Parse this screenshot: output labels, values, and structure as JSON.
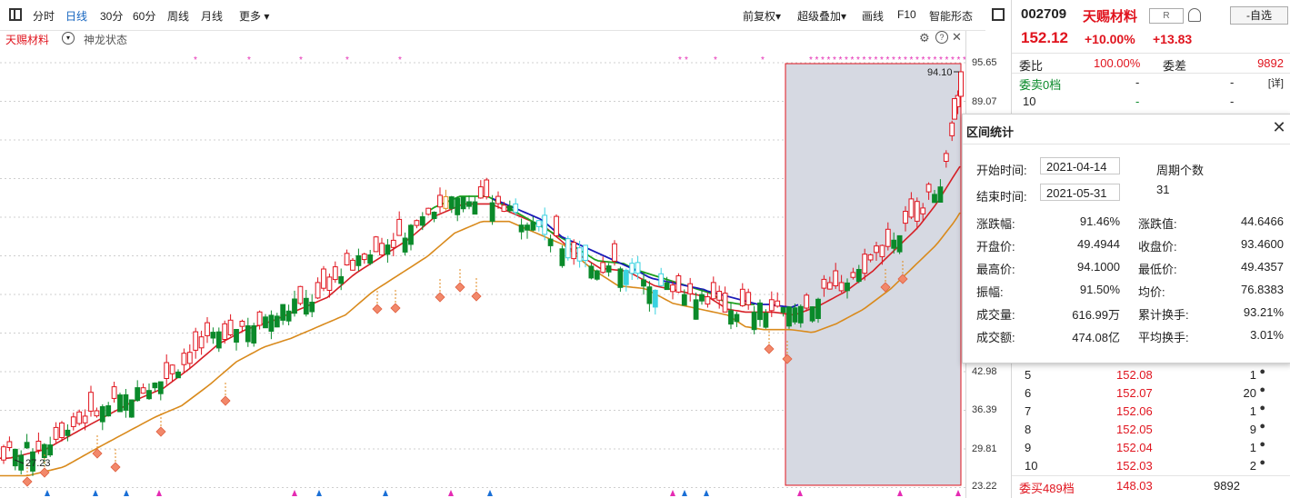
{
  "toolbar": {
    "tabs": [
      "分时",
      "日线",
      "30分",
      "60分",
      "周线",
      "月线",
      "更多"
    ],
    "active_tab": "日线",
    "right_items": [
      "前复权",
      "超级叠加",
      "画线",
      "F10",
      "智能形态"
    ]
  },
  "subbar": {
    "stock_label": "天赐材料",
    "indicator_label": "神龙状态"
  },
  "price_axis": {
    "labels": [
      "95.65",
      "89.07",
      "42.98",
      "36.39",
      "29.81",
      "23.22"
    ]
  },
  "chart_labels": {
    "high_marker": "94.10",
    "low_marker": "27.23"
  },
  "colors": {
    "up": "#e0141e",
    "down": "#0a8a2a",
    "ma_short": "#d61f26",
    "ma_long": "#d98a1c",
    "state_green": "#1ea01e",
    "state_blue": "#1a1ab8",
    "selection": "#d6d9e2"
  },
  "side": {
    "code": "002709",
    "name": "天赐材料",
    "badge": "R",
    "self_select": "-自选",
    "price": "152.12",
    "pct": "+10.00%",
    "change": "+13.83",
    "weibi_label": "委比",
    "weibi_value": "100.00%",
    "weicha_label": "委差",
    "weicha_value": "9892",
    "sell_label": "委卖0档",
    "sell_dash1": "-",
    "sell_dash2": "-",
    "detail": "[详]",
    "row10_level": "10",
    "row10_dash1": "-",
    "row10_dash2": "-",
    "buy_rows": [
      {
        "level": "5",
        "price": "152.08",
        "vol": "1"
      },
      {
        "level": "6",
        "price": "152.07",
        "vol": "20"
      },
      {
        "level": "7",
        "price": "152.06",
        "vol": "1"
      },
      {
        "level": "8",
        "price": "152.05",
        "vol": "9"
      },
      {
        "level": "9",
        "price": "152.04",
        "vol": "1"
      },
      {
        "level": "10",
        "price": "152.03",
        "vol": "2"
      }
    ],
    "buy_total_label": "委买489档",
    "buy_total_price": "148.03",
    "buy_total_vol": "9892"
  },
  "popup": {
    "title": "区间统计",
    "start_label": "开始时间:",
    "start_value": "2021-04-14",
    "end_label": "结束时间:",
    "end_value": "2021-05-31",
    "period_label": "周期个数",
    "period_value": "31",
    "stats": [
      {
        "l1": "涨跌幅:",
        "v1": "91.46%",
        "l2": "涨跌值:",
        "v2": "44.6466"
      },
      {
        "l1": "开盘价:",
        "v1": "49.4944",
        "l2": "收盘价:",
        "v2": "93.4600"
      },
      {
        "l1": "最高价:",
        "v1": "94.1000",
        "l2": "最低价:",
        "v2": "49.4357"
      },
      {
        "l1": "振幅:",
        "v1": "91.50%",
        "l2": "均价:",
        "v2": "76.8383"
      },
      {
        "l1": "成交量:",
        "v1": "616.99万",
        "l2": "累计换手:",
        "v2": "93.21%"
      },
      {
        "l1": "成交额:",
        "v1": "474.08亿",
        "l2": "平均换手:",
        "v2": "3.01%"
      }
    ]
  }
}
